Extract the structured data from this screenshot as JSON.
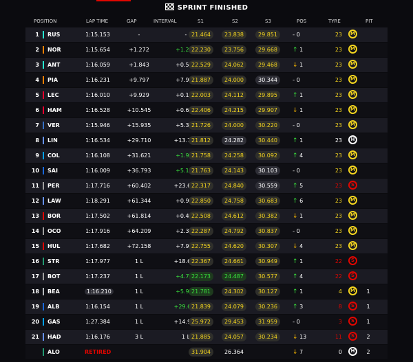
{
  "header_title": "SPRINT FINISHED",
  "columns": {
    "position": "POSITION",
    "lap_time": "LAP TIME",
    "gap": "GAP",
    "interval": "INTERVAL",
    "s1": "S1",
    "s2": "S2",
    "s3": "S3",
    "pos": "POS",
    "tyre": "TYRE",
    "pit": "PIT"
  },
  "colors": {
    "yellow": "#f4d51f",
    "green": "#39e23d",
    "red": "#e10600",
    "orange": "#f4b400"
  },
  "rows": [
    {
      "pos": "1",
      "code": "RUS",
      "team": "#27f4d2",
      "lap": "1:15.153",
      "lapbox": false,
      "gap": "-",
      "int": "-",
      "intc": "",
      "s1": "21.464",
      "s1c": "yellow",
      "s2": "23.838",
      "s2c": "yellow",
      "s3": "29.851",
      "s3c": "yellow",
      "arrow": "-",
      "dir": "zero",
      "change": "0",
      "tyre_laps": "23",
      "tyre": "M",
      "tyrec": "#f4d51f",
      "pit": ""
    },
    {
      "pos": "2",
      "code": "NOR",
      "team": "#ff8000",
      "lap": "1:15.654",
      "lapbox": false,
      "gap": "+1.272",
      "int": "+1.272",
      "intc": "green",
      "s1": "22.230",
      "s1c": "yellow",
      "s2": "23.756",
      "s2c": "yellow",
      "s3": "29.668",
      "s3c": "yellow",
      "arrow": "↑",
      "dir": "up",
      "change": "1",
      "tyre_laps": "23",
      "tyre": "M",
      "tyrec": "#f4d51f",
      "pit": ""
    },
    {
      "pos": "3",
      "code": "ANT",
      "team": "#27f4d2",
      "lap": "1:16.059",
      "lapbox": false,
      "gap": "+1.843",
      "int": "+0.571",
      "intc": "",
      "s1": "22.529",
      "s1c": "yellow",
      "s2": "24.062",
      "s2c": "yellow",
      "s3": "29.468",
      "s3c": "yellow",
      "arrow": "↓",
      "dir": "down",
      "change": "1",
      "tyre_laps": "23",
      "tyre": "M",
      "tyrec": "#f4d51f",
      "pit": ""
    },
    {
      "pos": "4",
      "code": "PIA",
      "team": "#ff8000",
      "lap": "1:16.231",
      "lapbox": false,
      "gap": "+9.797",
      "int": "+7.954",
      "intc": "",
      "s1": "21.887",
      "s1c": "yellow",
      "s2": "24.000",
      "s2c": "yellow",
      "s3": "30.344",
      "s3c": "grey",
      "arrow": "-",
      "dir": "zero",
      "change": "0",
      "tyre_laps": "23",
      "tyre": "M",
      "tyrec": "#f4d51f",
      "pit": ""
    },
    {
      "pos": "5",
      "code": "LEC",
      "team": "#e8002d",
      "lap": "1:16.010",
      "lapbox": false,
      "gap": "+9.929",
      "int": "+0.132",
      "intc": "",
      "s1": "22.003",
      "s1c": "yellow",
      "s2": "24.112",
      "s2c": "yellow",
      "s3": "29.895",
      "s3c": "yellow",
      "arrow": "↑",
      "dir": "up",
      "change": "1",
      "tyre_laps": "23",
      "tyre": "M",
      "tyrec": "#f4d51f",
      "pit": ""
    },
    {
      "pos": "6",
      "code": "HAM",
      "team": "#e8002d",
      "lap": "1:16.528",
      "lapbox": false,
      "gap": "+10.545",
      "int": "+0.616",
      "intc": "",
      "s1": "22.406",
      "s1c": "yellow",
      "s2": "24.215",
      "s2c": "yellow",
      "s3": "29.907",
      "s3c": "yellow",
      "arrow": "↓",
      "dir": "down",
      "change": "1",
      "tyre_laps": "23",
      "tyre": "M",
      "tyrec": "#f4d51f",
      "pit": ""
    },
    {
      "pos": "7",
      "code": "VER",
      "team": "#3671c6",
      "lap": "1:15.946",
      "lapbox": false,
      "gap": "+15.935",
      "int": "+5.390",
      "intc": "",
      "s1": "21.726",
      "s1c": "yellow",
      "s2": "24.000",
      "s2c": "yellow",
      "s3": "30.220",
      "s3c": "yellow",
      "arrow": "-",
      "dir": "zero",
      "change": "0",
      "tyre_laps": "23",
      "tyre": "M",
      "tyrec": "#f4d51f",
      "pit": ""
    },
    {
      "pos": "8",
      "code": "LIN",
      "team": "#6692ff",
      "lap": "1:16.534",
      "lapbox": false,
      "gap": "+29.710",
      "int": "+13.775",
      "intc": "",
      "s1": "21.812",
      "s1c": "yellow",
      "s2": "24.282",
      "s2c": "grey",
      "s3": "30.440",
      "s3c": "yellow",
      "arrow": "↑",
      "dir": "up",
      "change": "1",
      "tyre_laps": "23",
      "tyre": "H",
      "tyrec": "#ffffff",
      "pit": ""
    },
    {
      "pos": "9",
      "code": "COL",
      "team": "#00a1e8",
      "lap": "1:16.108",
      "lapbox": false,
      "gap": "+31.621",
      "int": "+1.911",
      "intc": "green",
      "s1": "21.758",
      "s1c": "yellow",
      "s2": "24.258",
      "s2c": "yellow",
      "s3": "30.092",
      "s3c": "yellow",
      "arrow": "↑",
      "dir": "up",
      "change": "4",
      "tyre_laps": "23",
      "tyre": "M",
      "tyrec": "#f4d51f",
      "pit": ""
    },
    {
      "pos": "10",
      "code": "SAI",
      "team": "#1868db",
      "lap": "1:16.009",
      "lapbox": false,
      "gap": "+36.793",
      "int": "+5.172",
      "intc": "green",
      "s1": "21.763",
      "s1c": "yellow",
      "s2": "24.143",
      "s2c": "yellow",
      "s3": "30.103",
      "s3c": "grey",
      "arrow": "-",
      "dir": "zero",
      "change": "0",
      "tyre_laps": "23",
      "tyre": "M",
      "tyrec": "#f4d51f",
      "pit": ""
    },
    {
      "pos": "11",
      "code": "PER",
      "team": "#a0a0a0",
      "lap": "1:17.716",
      "lapbox": false,
      "gap": "+60.402",
      "int": "+23.609",
      "intc": "",
      "s1": "22.317",
      "s1c": "yellow",
      "s2": "24.840",
      "s2c": "yellow",
      "s3": "30.559",
      "s3c": "grey",
      "arrow": "↑",
      "dir": "up",
      "change": "5",
      "tyre_laps": "23",
      "tyre": "S",
      "tyrec": "#e10600",
      "pit": ""
    },
    {
      "pos": "12",
      "code": "LAW",
      "team": "#6692ff",
      "lap": "1:18.291",
      "lapbox": false,
      "gap": "+61.344",
      "int": "+0.942",
      "intc": "",
      "s1": "22.850",
      "s1c": "yellow",
      "s2": "24.758",
      "s2c": "yellow",
      "s3": "30.683",
      "s3c": "yellow",
      "arrow": "↑",
      "dir": "up",
      "change": "6",
      "tyre_laps": "23",
      "tyre": "M",
      "tyrec": "#f4d51f",
      "pit": ""
    },
    {
      "pos": "13",
      "code": "BOR",
      "team": "#e10600",
      "lap": "1:17.502",
      "lapbox": false,
      "gap": "+61.814",
      "int": "+0.470",
      "intc": "",
      "s1": "22.508",
      "s1c": "yellow",
      "s2": "24.612",
      "s2c": "yellow",
      "s3": "30.382",
      "s3c": "yellow",
      "arrow": "↓",
      "dir": "down",
      "change": "1",
      "tyre_laps": "23",
      "tyre": "M",
      "tyrec": "#f4d51f",
      "pit": ""
    },
    {
      "pos": "14",
      "code": "OCO",
      "team": "#a0a0a0",
      "lap": "1:17.916",
      "lapbox": false,
      "gap": "+64.209",
      "int": "+2.395",
      "intc": "",
      "s1": "22.287",
      "s1c": "yellow",
      "s2": "24.792",
      "s2c": "yellow",
      "s3": "30.837",
      "s3c": "yellow",
      "arrow": "-",
      "dir": "zero",
      "change": "0",
      "tyre_laps": "23",
      "tyre": "M",
      "tyrec": "#f4d51f",
      "pit": ""
    },
    {
      "pos": "15",
      "code": "HUL",
      "team": "#e10600",
      "lap": "1:17.682",
      "lapbox": false,
      "gap": "+72.158",
      "int": "+7.949",
      "intc": "",
      "s1": "22.755",
      "s1c": "yellow",
      "s2": "24.620",
      "s2c": "yellow",
      "s3": "30.307",
      "s3c": "yellow",
      "arrow": "↓",
      "dir": "down",
      "change": "4",
      "tyre_laps": "23",
      "tyre": "M",
      "tyrec": "#f4d51f",
      "pit": ""
    },
    {
      "pos": "16",
      "code": "STR",
      "team": "#229971",
      "lap": "1:17.977",
      "lapbox": false,
      "gap": "1 L",
      "int": "+18.651",
      "intc": "",
      "s1": "22.367",
      "s1c": "yellow",
      "s2": "24.661",
      "s2c": "yellow",
      "s3": "30.949",
      "s3c": "yellow",
      "arrow": "↑",
      "dir": "up",
      "change": "1",
      "tyre_laps": "22",
      "tyre": "S",
      "tyrec": "#e10600",
      "pit": ""
    },
    {
      "pos": "17",
      "code": "BOT",
      "team": "#a0a0a0",
      "lap": "1:17.237",
      "lapbox": false,
      "gap": "1 L",
      "int": "+4.734",
      "intc": "green",
      "s1": "22.173",
      "s1c": "green",
      "s2": "24.487",
      "s2c": "green",
      "s3": "30.577",
      "s3c": "yellow",
      "arrow": "↑",
      "dir": "up",
      "change": "4",
      "tyre_laps": "22",
      "tyre": "S",
      "tyrec": "#e10600",
      "pit": ""
    },
    {
      "pos": "18",
      "code": "BEA",
      "team": "#b6babd",
      "lap": "1:16.210",
      "lapbox": true,
      "gap": "1 L",
      "int": "+5.985",
      "intc": "green",
      "s1": "21.781",
      "s1c": "green",
      "s2": "24.302",
      "s2c": "yellow",
      "s3": "30.127",
      "s3c": "yellow",
      "arrow": "↑",
      "dir": "up",
      "change": "1",
      "tyre_laps": "4",
      "tyre": "M",
      "tyrec": "#f4d51f",
      "pit": "1"
    },
    {
      "pos": "19",
      "code": "ALB",
      "team": "#1868db",
      "lap": "1:16.154",
      "lapbox": false,
      "gap": "1 L",
      "int": "+29.647",
      "intc": "green",
      "s1": "21.839",
      "s1c": "yellow",
      "s2": "24.079",
      "s2c": "yellow",
      "s3": "30.236",
      "s3c": "yellow",
      "arrow": "↑",
      "dir": "up",
      "change": "3",
      "tyre_laps": "8",
      "tyre": "S",
      "tyrec": "#e10600",
      "pit": "1"
    },
    {
      "pos": "20",
      "code": "GAS",
      "team": "#00a1e8",
      "lap": "1:27.384",
      "lapbox": false,
      "gap": "1 L",
      "int": "+14.984",
      "intc": "",
      "s1": "25.972",
      "s1c": "yellow",
      "s2": "29.453",
      "s2c": "yellow",
      "s3": "31.959",
      "s3c": "yellow",
      "arrow": "-",
      "dir": "zero",
      "change": "0",
      "tyre_laps": "3",
      "tyre": "S",
      "tyrec": "#e10600",
      "pit": "1"
    },
    {
      "pos": "21",
      "code": "HAD",
      "team": "#6692ff",
      "lap": "1:16.176",
      "lapbox": false,
      "gap": "3 L",
      "int": "1 L",
      "intc": "",
      "s1": "21.885",
      "s1c": "yellow",
      "s2": "24.057",
      "s2c": "yellow",
      "s3": "30.234",
      "s3c": "yellow",
      "arrow": "↓",
      "dir": "down",
      "change": "13",
      "tyre_laps": "11",
      "tyre": "S",
      "tyrec": "#e10600",
      "pit": "2"
    },
    {
      "pos": "",
      "code": "ALO",
      "team": "#229971",
      "lap": "RETIRED",
      "lapbox": false,
      "retired": true,
      "gap": "",
      "int": "",
      "intc": "",
      "s1": "31.904",
      "s1c": "yellow",
      "s2": "26.364",
      "s2c": "none",
      "s3": "",
      "s3c": "none",
      "arrow": "↓",
      "dir": "down",
      "change": "7",
      "tyre_laps": "0",
      "tyre": "H",
      "tyrec": "#ffffff",
      "pit": "2"
    }
  ]
}
